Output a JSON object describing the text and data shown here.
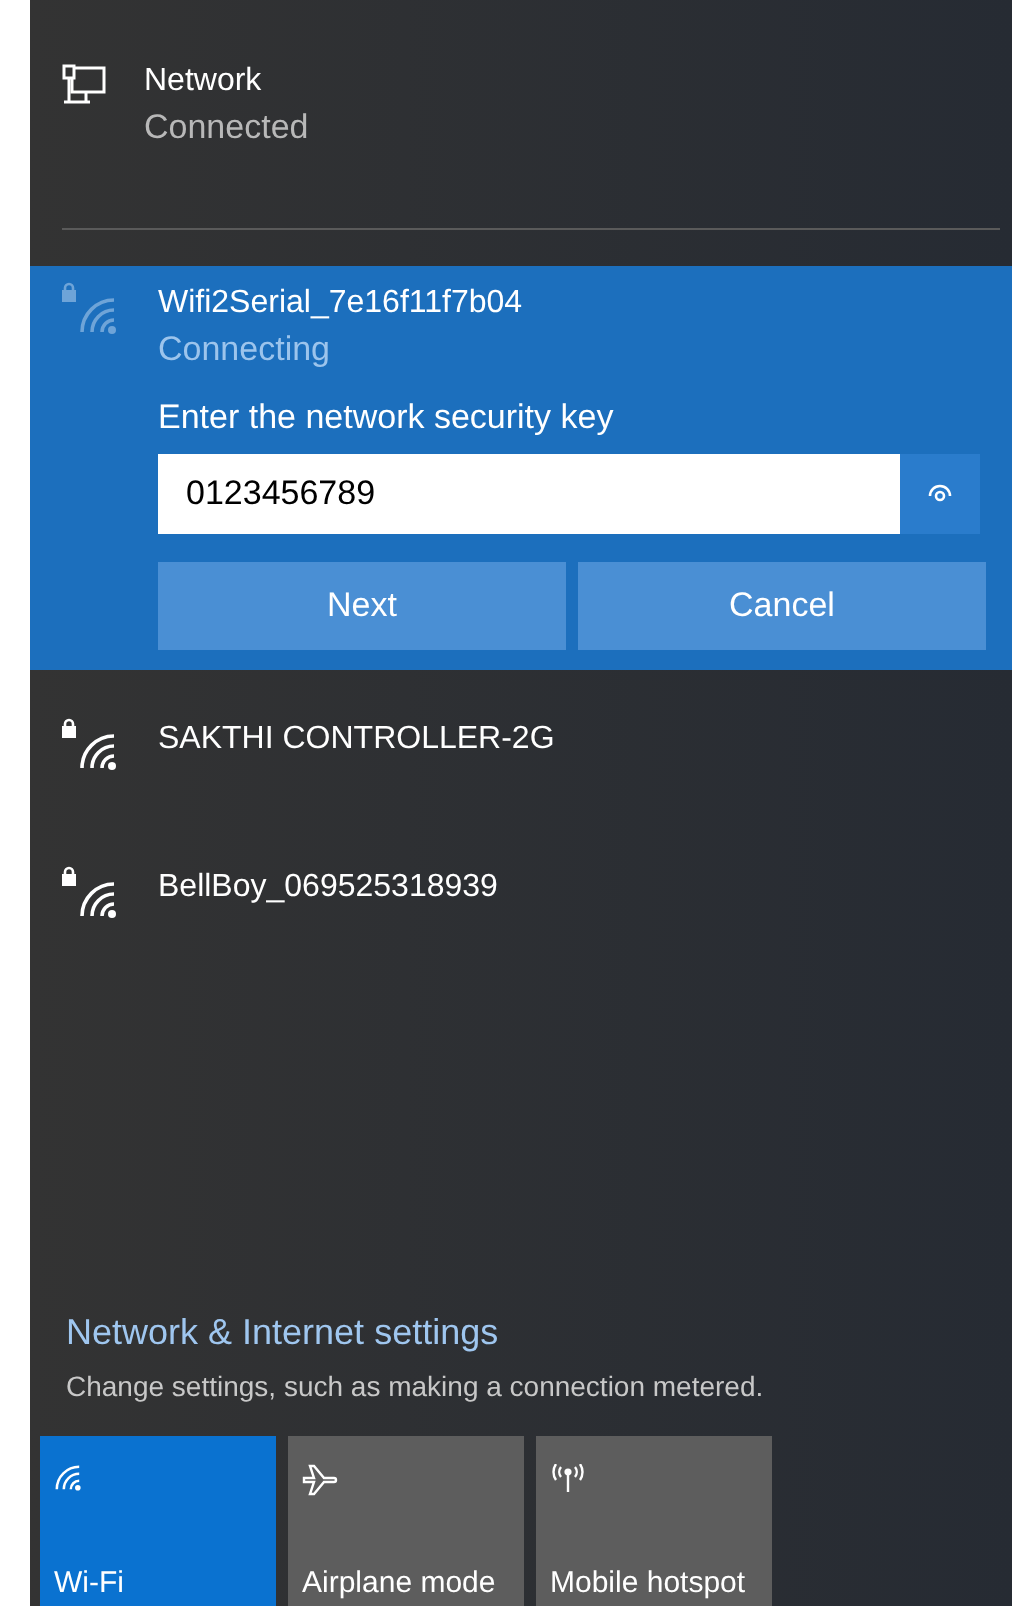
{
  "wired": {
    "name": "Network",
    "status": "Connected"
  },
  "networks": [
    {
      "name": "Wifi2Serial_7e16f11f7b04",
      "status": "Connecting",
      "selected": true,
      "key_form": {
        "label": "Enter the network security key",
        "value": "0123456789",
        "buttons": [
          "Next",
          "Cancel"
        ]
      }
    },
    {
      "name": "SAKTHI CONTROLLER-2G",
      "selected": false
    },
    {
      "name": "BellBoy_069525318939",
      "selected": false
    }
  ],
  "settings": {
    "link": "Network & Internet settings",
    "description": "Change settings, such as making a connection metered."
  },
  "quick_actions": [
    {
      "kind": "wifi",
      "label": "Wi-Fi",
      "on": true
    },
    {
      "kind": "airplane",
      "label": "Airplane mode",
      "on": false
    },
    {
      "kind": "hotspot",
      "label": "Mobile hotspot",
      "on": false
    }
  ]
}
